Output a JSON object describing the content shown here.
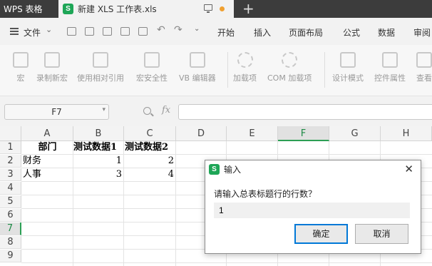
{
  "titlebar": {
    "app_tab": "WPS 表格",
    "doc_icon": "S",
    "doc_tab": "新建 XLS 工作表.xls",
    "new_tab": "+"
  },
  "menubar": {
    "file": "文件",
    "tabs": [
      "开始",
      "插入",
      "页面布局",
      "公式",
      "数据",
      "审阅"
    ]
  },
  "toolbar": {
    "tools": [
      "宏",
      "录制新宏",
      "使用相对引用",
      "宏安全性",
      "VB 编辑器",
      "加载项",
      "COM 加载项",
      "设计模式",
      "控件属性",
      "查看"
    ]
  },
  "formulabar": {
    "namebox": "F7",
    "fx": "fx",
    "formula": ""
  },
  "sheet": {
    "columns": [
      "A",
      "B",
      "C",
      "D",
      "E",
      "F",
      "G",
      "H"
    ],
    "rows": [
      "1",
      "2",
      "3",
      "4",
      "5",
      "6",
      "7",
      "8",
      "9"
    ],
    "active_column": "F",
    "active_row": "7",
    "cells": {
      "A1": "部门",
      "B1": "测试数据1",
      "C1": "测试数据2",
      "A2": "财务",
      "B2": "1",
      "C2": "2",
      "A3": "人事",
      "B3": "3",
      "C3": "4"
    }
  },
  "dialog": {
    "icon": "S",
    "title": "输入",
    "close": "✕",
    "prompt": "请输入总表标题行的行数？",
    "input_value": "1",
    "ok": "确定",
    "cancel": "取消"
  },
  "colors": {
    "wps_green": "#1ea657",
    "selection_green": "#2c9f55",
    "titlebar_dark": "#3c3c3c",
    "dialog_focus_blue": "#0078d7"
  }
}
